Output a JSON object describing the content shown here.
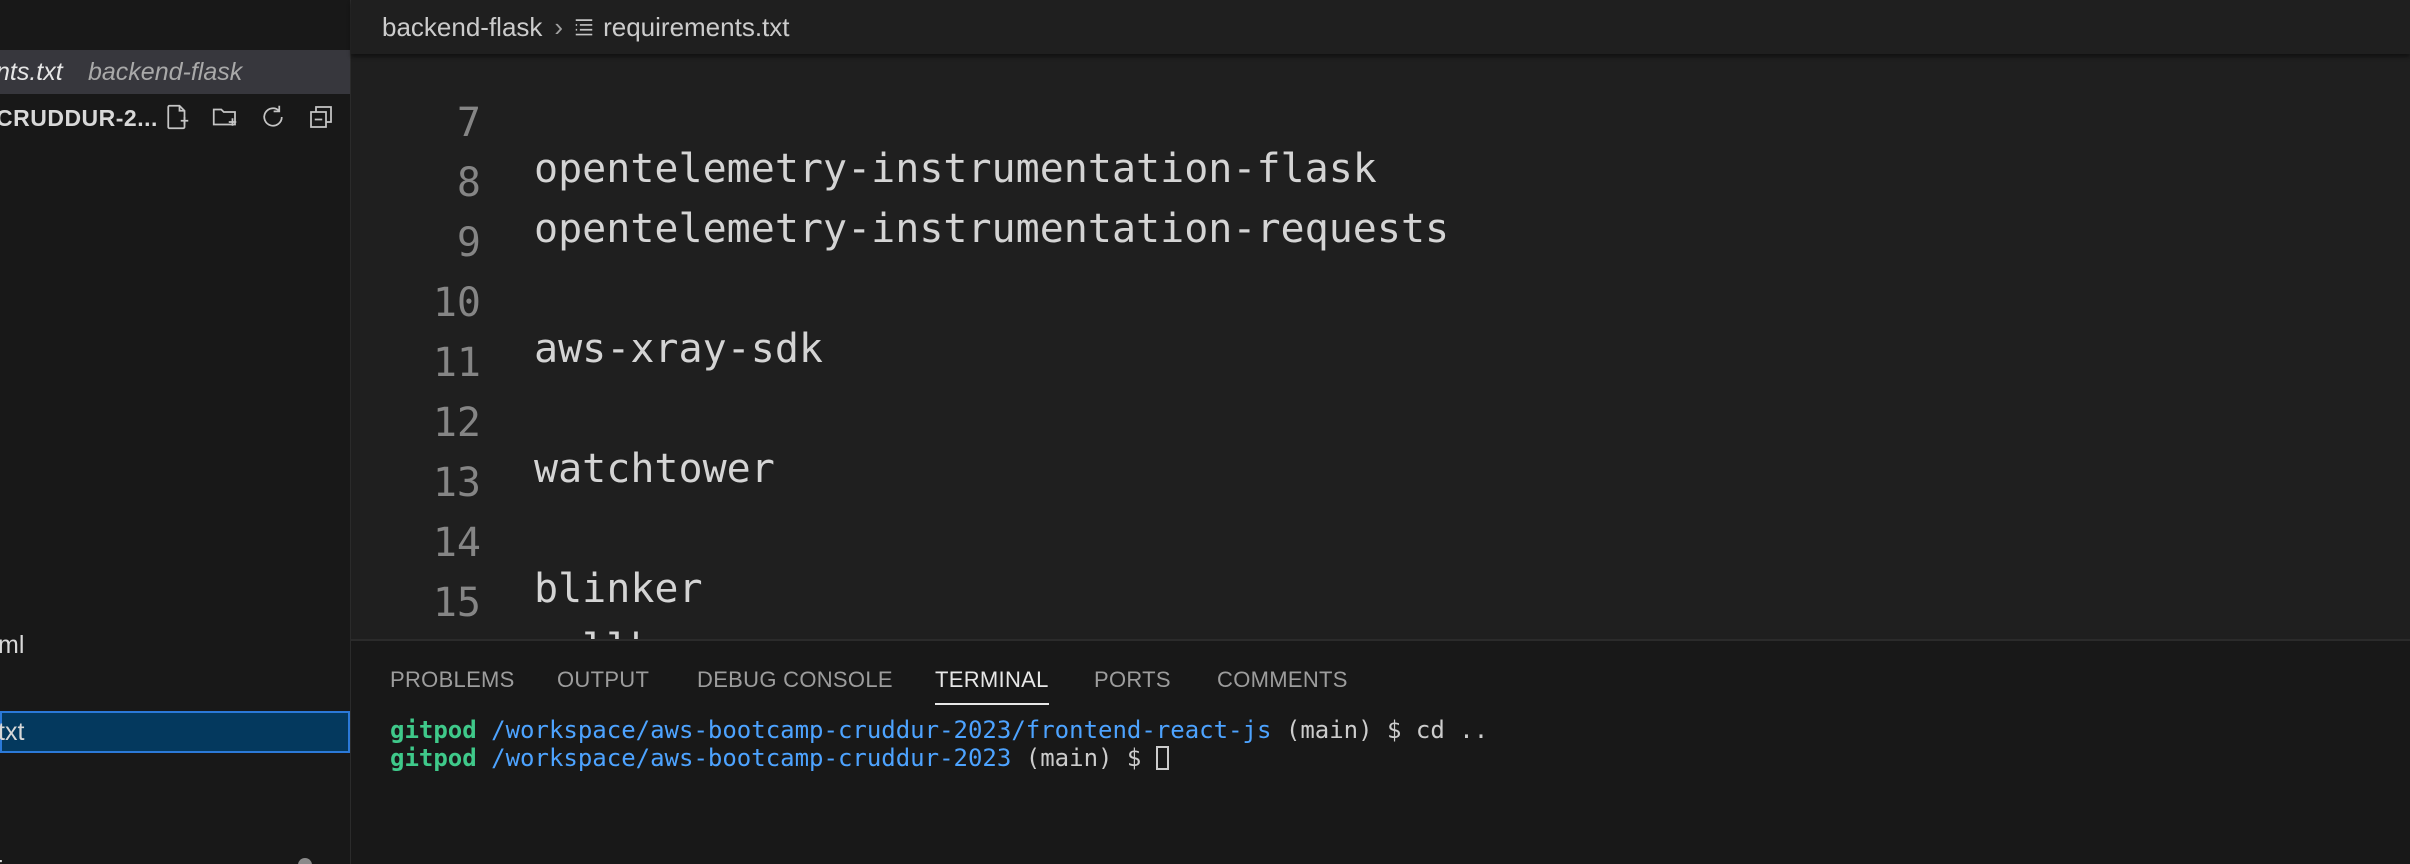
{
  "sidebar": {
    "open_editor": {
      "file": "nts.txt",
      "folder": "backend-flask"
    },
    "explorer": {
      "project": "CRUDDUR-2...",
      "actions": [
        "new-file-icon",
        "new-folder-icon",
        "refresh-icon",
        "collapse-all-icon"
      ]
    },
    "tree": {
      "item_yml": "ml",
      "item_txt": "txt",
      "item_js": "js"
    }
  },
  "breadcrumb": {
    "folder": "backend-flask",
    "file": "requirements.txt"
  },
  "editor": {
    "lines": [
      {
        "num": "7",
        "text": "opentelemetry-instrumentation-flask"
      },
      {
        "num": "8",
        "text": "opentelemetry-instrumentation-requests"
      },
      {
        "num": "9",
        "text": ""
      },
      {
        "num": "10",
        "text": "aws-xray-sdk"
      },
      {
        "num": "11",
        "text": ""
      },
      {
        "num": "12",
        "text": "watchtower"
      },
      {
        "num": "13",
        "text": ""
      },
      {
        "num": "14",
        "text": "blinker"
      },
      {
        "num": "15",
        "text": "rollbar"
      }
    ]
  },
  "panel": {
    "tabs": {
      "problems": "PROBLEMS",
      "output": "OUTPUT",
      "debug_console": "DEBUG CONSOLE",
      "terminal": "TERMINAL",
      "ports": "PORTS",
      "comments": "COMMENTS"
    },
    "active_tab": "TERMINAL",
    "terminal": {
      "line1": {
        "user": "gitpod",
        "path": "/workspace/aws-bootcamp-cruddur-2023/frontend-react-js",
        "rest": " (main) $ cd .."
      },
      "line2": {
        "user": "gitpod",
        "path": "/workspace/aws-bootcamp-cruddur-2023",
        "rest": " (main) $ "
      }
    }
  },
  "colors": {
    "editor_bg": "#1f1f1f",
    "sidebar_bg": "#181818",
    "selection": "#04395e",
    "focus_border": "#2b79d8",
    "terminal_user": "#3fc98a",
    "terminal_path": "#4da3ff"
  }
}
